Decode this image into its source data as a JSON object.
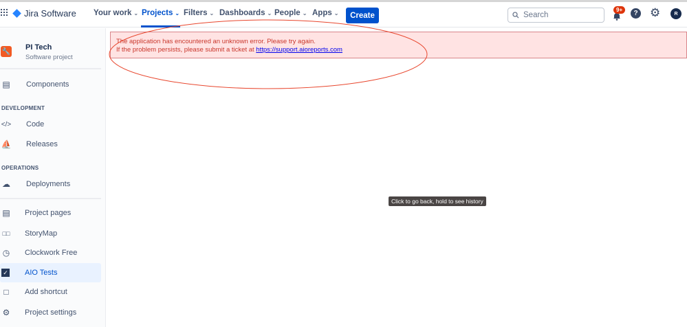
{
  "header": {
    "app_name": "Jira Software",
    "nav": [
      {
        "label": "Your work"
      },
      {
        "label": "Projects",
        "active": true
      },
      {
        "label": "Filters"
      },
      {
        "label": "Dashboards"
      },
      {
        "label": "People"
      },
      {
        "label": "Apps"
      }
    ],
    "create_label": "Create",
    "search_placeholder": "Search",
    "notifications_badge": "9+",
    "avatar_initial": "R"
  },
  "sidebar": {
    "project_name": "PI Tech",
    "project_type": "Software project",
    "components": "Components",
    "development_title": "DEVELOPMENT",
    "code": "Code",
    "releases": "Releases",
    "operations_title": "OPERATIONS",
    "deployments": "Deployments",
    "project_pages": "Project pages",
    "storymap": "StoryMap",
    "clockwork": "Clockwork Free",
    "aio_tests": "AIO Tests",
    "add_shortcut": "Add shortcut",
    "project_settings": "Project settings"
  },
  "error": {
    "line1": "The application has encountered an unknown error. Please try again.",
    "line2_prefix": "If the problem persists, please submit a ticket at ",
    "link": "https://support.aioreports.com"
  },
  "tooltip": "Click to go back, hold to see history",
  "colors": {
    "brand": "#0052cc",
    "error_bg": "#ffe3e3",
    "annotation": "#e8452c"
  }
}
